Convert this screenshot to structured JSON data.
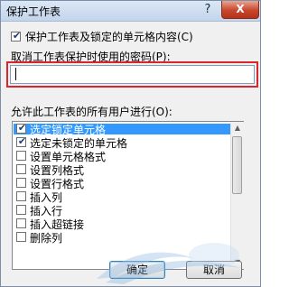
{
  "window": {
    "title": "保护工作表",
    "help_glyph": "?",
    "close_glyph": "X"
  },
  "protect_checkbox": {
    "label": "保护工作表及锁定的单元格内容(C)",
    "checked": true
  },
  "password": {
    "label": "取消工作表保护时使用的密码(P):",
    "value": ""
  },
  "permissions": {
    "label": "允许此工作表的所有用户进行(O):",
    "items": [
      {
        "label": "选定锁定单元格",
        "checked": true,
        "selected": true
      },
      {
        "label": "选定未锁定的单元格",
        "checked": true,
        "selected": false
      },
      {
        "label": "设置单元格格式",
        "checked": false,
        "selected": false
      },
      {
        "label": "设置列格式",
        "checked": false,
        "selected": false
      },
      {
        "label": "设置行格式",
        "checked": false,
        "selected": false
      },
      {
        "label": "插入列",
        "checked": false,
        "selected": false
      },
      {
        "label": "插入行",
        "checked": false,
        "selected": false
      },
      {
        "label": "插入超链接",
        "checked": false,
        "selected": false
      },
      {
        "label": "删除列",
        "checked": false,
        "selected": false
      }
    ]
  },
  "buttons": {
    "ok": "确定",
    "cancel": "取消"
  },
  "colors": {
    "selection": "#3399ff",
    "highlight_frame": "#d9252b",
    "title_gradient_top": "#dbe7f5",
    "close_button": "#c7472c"
  },
  "icons": {
    "help": "help-icon",
    "close": "close-icon",
    "scroll_up": "chevron-up-icon",
    "scroll_down": "chevron-down-icon"
  }
}
